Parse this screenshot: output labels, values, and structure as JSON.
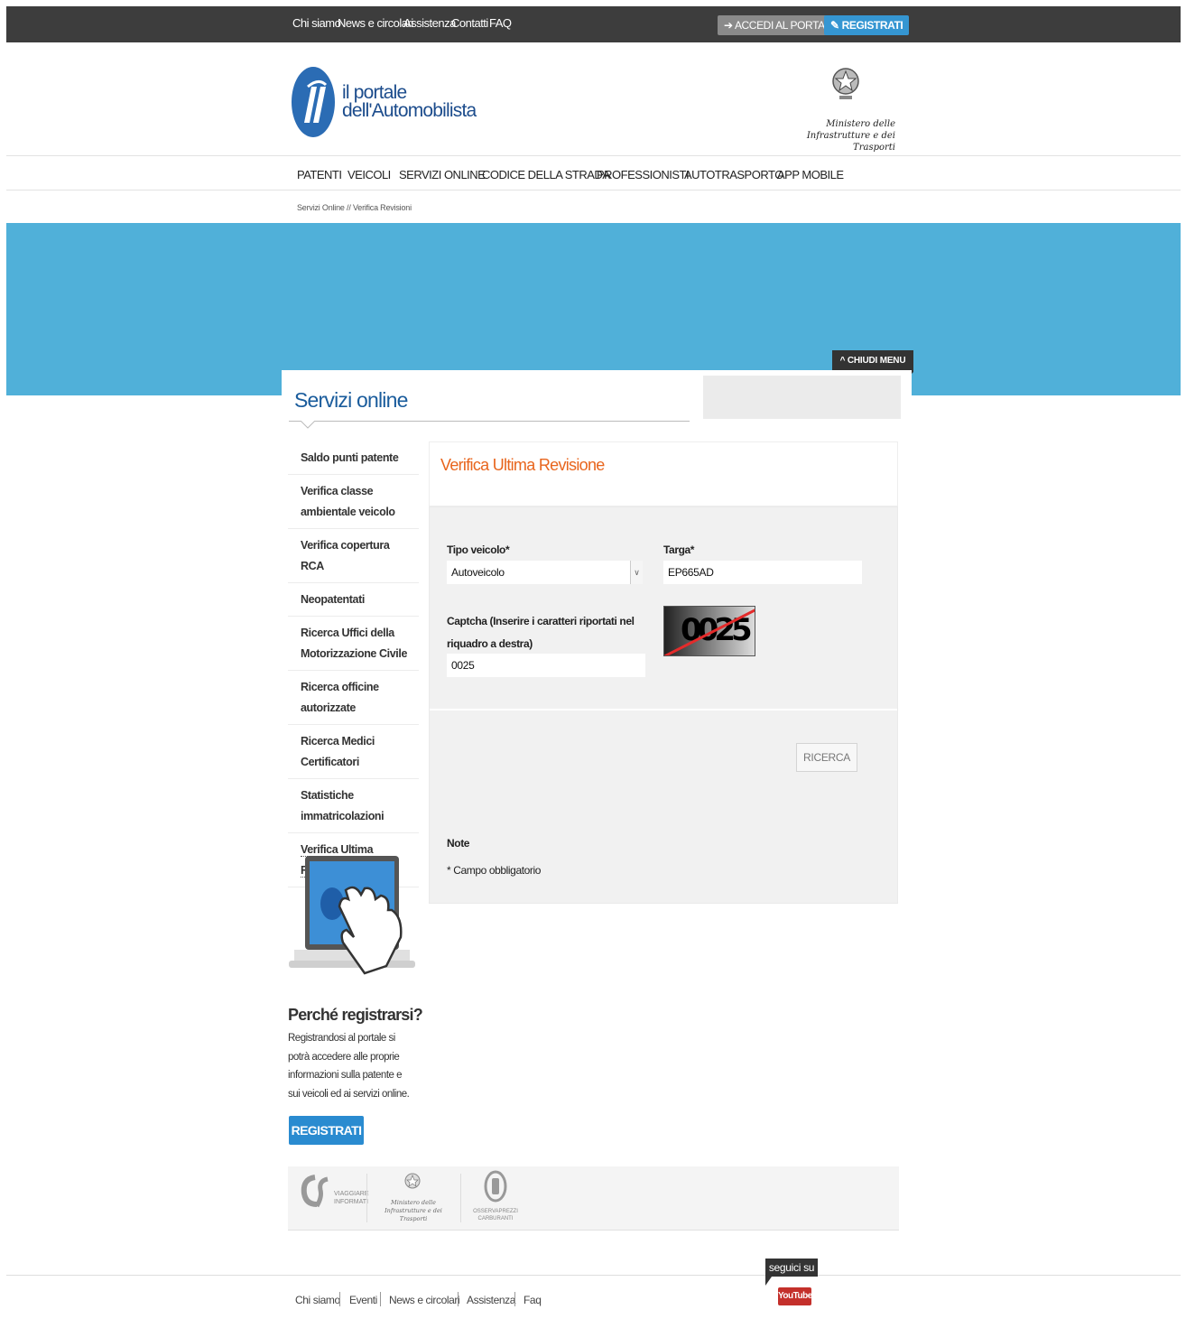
{
  "topbar": {
    "links": [
      "Chi siamo",
      "News e circolari",
      "Assistenza",
      "Contatti",
      "FAQ"
    ],
    "accedi_label": "ACCEDI AL PORTALE",
    "registrati_label": "REGISTRATI"
  },
  "header": {
    "logo_line1": "il portale",
    "logo_line2": "dell'Automobilista",
    "ministero_line1": "Ministero delle",
    "ministero_line2": "Infrastrutture e dei Trasporti"
  },
  "nav": [
    "PATENTI",
    "VEICOLI",
    "SERVIZI ONLINE",
    "CODICE DELLA STRADA",
    "PROFESSIONISTI",
    "AUTOTRASPORTO",
    "APP MOBILE"
  ],
  "breadcrumb": {
    "first": "Servizi Online",
    "separator": "//",
    "current": "Verifica Revisioni"
  },
  "banner": {
    "chiudi_label": "CHIUDI MENU"
  },
  "main": {
    "title": "Servizi online"
  },
  "sidebar": {
    "items": [
      "Saldo punti patente",
      "Verifica classe ambientale veicolo",
      "Verifica copertura RCA",
      "Neopatentati",
      "Ricerca Uffici della Motorizzazione Civile",
      "Ricerca officine autorizzate",
      "Ricerca Medici Certificatori",
      "Statistiche immatricolazioni",
      "Verifica Ultima Revisione"
    ]
  },
  "form": {
    "title": "Verifica Ultima Revisione",
    "tipo_label": "Tipo veicolo*",
    "tipo_value": "Autoveicolo",
    "targa_label": "Targa*",
    "targa_value": "EP665AD",
    "captcha_label": "Captcha (Inserire i caratteri riportati nel riquadro a destra)",
    "captcha_value": "0025",
    "captcha_image_text": "0025",
    "ricerca_label": "RICERCA",
    "note_title": "Note",
    "note_text": "* Campo obbligatorio"
  },
  "promo": {
    "title": "Perché registrarsi?",
    "text": "Registrandosi al portale si potrà accedere alle proprie informazioni sulla patente e sui  veicoli ed ai servizi online.",
    "button_label": "REGISTRATI"
  },
  "partners": {
    "viaggiare": "VIAGGIARE INFORMATI",
    "ministero_line1": "Ministero delle",
    "ministero_line2": "Infrastrutture e dei Trasporti",
    "osservaprezzi_line1": "OSSERVAPREZZI",
    "osservaprezzi_line2": "CARBURANTI"
  },
  "footer": {
    "links": [
      "Chi siamo",
      "Eventi",
      "News e circolari",
      "Assistenza",
      "Faq"
    ],
    "seguici": "seguici su",
    "youtube_you": "You",
    "youtube_tube": "Tube"
  },
  "colors": {
    "topbar": "#3d3d3d",
    "banner": "#50b0d9",
    "accent_orange": "#e8651d",
    "title_blue": "#1a5c9c",
    "button_blue": "#2a8bd0"
  }
}
